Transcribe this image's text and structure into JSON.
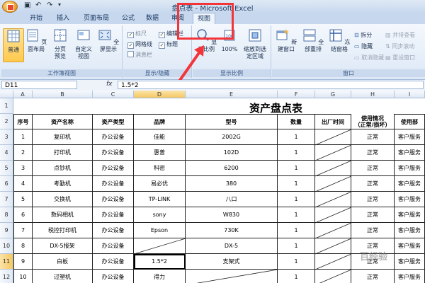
{
  "window": {
    "title": "盘点表 - Microsoft Excel"
  },
  "tabs": [
    "开始",
    "插入",
    "页面布局",
    "公式",
    "数据",
    "审阅",
    "视图"
  ],
  "active_tab": "视图",
  "ribbon": {
    "groups": {
      "workbook_views": "工作簿视图",
      "show_hide": "显示/隐藏",
      "zoom": "显示比例",
      "window": "窗口"
    },
    "buttons": {
      "normal": "普通",
      "page_layout": "页面布局",
      "page_break_preview": "分页预览",
      "custom_views": "自定义视图",
      "full_screen": "全屏显示",
      "zoom": "显示比例",
      "zoom_100": "100%",
      "zoom_to_selection": "缩放到选定区域",
      "new_window": "新建窗口",
      "arrange_all": "全部重排",
      "freeze_panes": "冻结窗格",
      "split": "拆分",
      "hide": "隐藏",
      "unhide": "取消隐藏",
      "view_side_by_side": "并排查看",
      "synchronous_scrolling": "同步滚动",
      "reset_window_position": "重设窗口"
    },
    "checkboxes": {
      "ruler": "标尺",
      "formula_bar": "编辑栏",
      "gridlines": "网格线",
      "headings": "标题",
      "message_bar": "消息栏"
    }
  },
  "formula_bar": {
    "name_box": "D11",
    "fx": "fx",
    "value": "1.5*2"
  },
  "columns": [
    "A",
    "B",
    "C",
    "D",
    "E",
    "F",
    "G",
    "H",
    "I"
  ],
  "selected_column": "D",
  "rows": [
    "1",
    "2",
    "3",
    "4",
    "5",
    "6",
    "7",
    "8",
    "9",
    "10",
    "11",
    "12"
  ],
  "selected_row": "11",
  "sheet": {
    "title": "资产盘点表",
    "headers": [
      "序号",
      "资产名称",
      "资产类型",
      "品牌",
      "型号",
      "数量",
      "出厂时间",
      "使用情况（正常/损坏）",
      "使用部"
    ],
    "header_h_line1": "使用情况",
    "header_h_line2": "（正常/损坏）",
    "rows": [
      [
        "1",
        "复印机",
        "办公设备",
        "佳能",
        "2002G",
        "1",
        "",
        "正常",
        "客户服务"
      ],
      [
        "2",
        "打印机",
        "办公设备",
        "惠普",
        "102D",
        "1",
        "",
        "正常",
        "客户服务"
      ],
      [
        "3",
        "点钞机",
        "办公设备",
        "科密",
        "6200",
        "1",
        "",
        "正常",
        "客户服务"
      ],
      [
        "4",
        "考勤机",
        "办公设备",
        "易必优",
        "380",
        "1",
        "",
        "正常",
        "客户服务"
      ],
      [
        "5",
        "交换机",
        "办公设备",
        "TP-LINK",
        "八口",
        "1",
        "",
        "正常",
        "客户服务"
      ],
      [
        "6",
        "数码相机",
        "办公设备",
        "sony",
        "W830",
        "1",
        "",
        "正常",
        "客户服务"
      ],
      [
        "7",
        "税控打印机",
        "办公设备",
        "Epson",
        "730K",
        "1",
        "",
        "正常",
        "客户服务"
      ],
      [
        "8",
        "DX-5报架",
        "办公设备",
        "",
        "DX-5",
        "1",
        "",
        "正常",
        "客户服务"
      ],
      [
        "9",
        "白板",
        "办公设备",
        "1.5*2",
        "支架式",
        "1",
        "",
        "正常",
        "客户服务"
      ],
      [
        "10",
        "过塑机",
        "办公设备",
        "得力",
        "",
        "1",
        "",
        "正常",
        "客户服务"
      ]
    ]
  },
  "watermark": "百经验",
  "colors": {
    "accent_red": "#f3353a",
    "ribbon_blue": "#dce8f6",
    "selected_header": "#f5c862"
  }
}
